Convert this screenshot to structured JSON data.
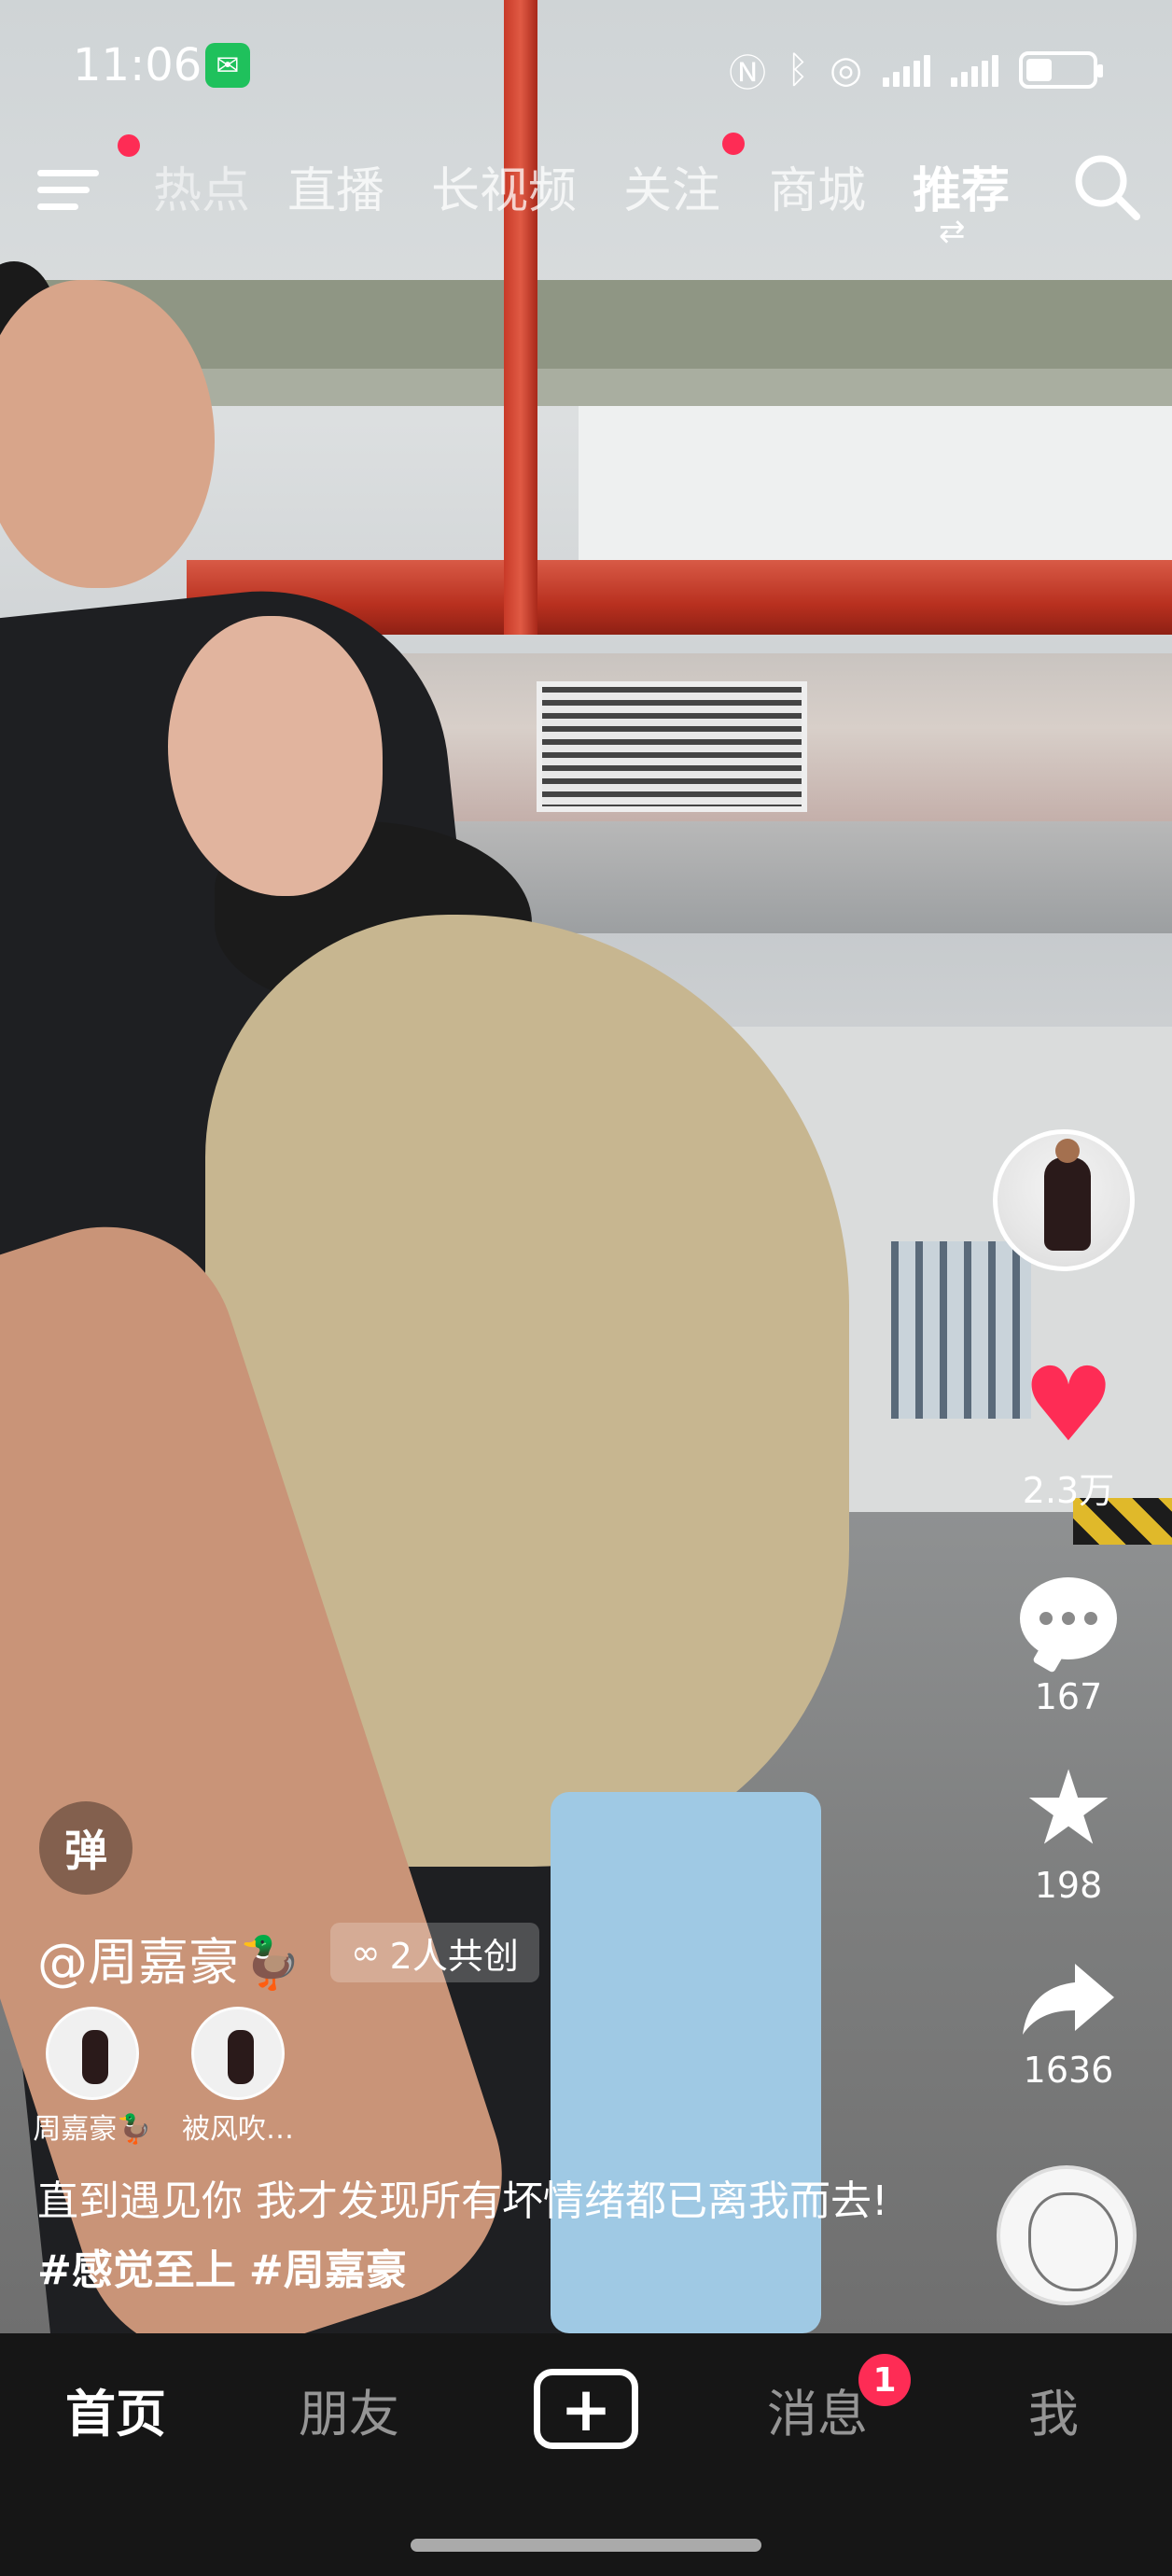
{
  "status_bar": {
    "time": "11:06",
    "battery_level": 0.4
  },
  "top_tabs": [
    {
      "label": "热点",
      "active": false
    },
    {
      "label": "直播",
      "active": false
    },
    {
      "label": "长视频",
      "active": false
    },
    {
      "label": "关注",
      "active": false
    },
    {
      "label": "商城",
      "active": false
    },
    {
      "label": "推荐",
      "active": true
    }
  ],
  "actions": {
    "likes": "2.3万",
    "comments": "167",
    "favorites": "198",
    "shares": "1636"
  },
  "video_info": {
    "danmu_label": "弹",
    "author": "@周嘉豪🦆",
    "cocreate_label": "2人共创",
    "creators": [
      {
        "name": "周嘉豪🦆"
      },
      {
        "name": "被风吹…"
      }
    ],
    "description_text": "直到遇见你 我才发现所有坏情绪都已离我而去! ",
    "hashtags": [
      "#感觉至上",
      "#周嘉豪"
    ]
  },
  "bottom_tabs": {
    "home": "首页",
    "friends": "朋友",
    "messages": "消息",
    "messages_badge": "1",
    "me": "我"
  },
  "colors": {
    "accent": "#fe2c55",
    "tabbar_bg": "#161616"
  },
  "icons": [
    "menu-icon",
    "search-icon",
    "switch-icon",
    "heart-icon",
    "comment-icon",
    "star-icon",
    "share-icon",
    "plus-icon",
    "wechat-icon"
  ]
}
